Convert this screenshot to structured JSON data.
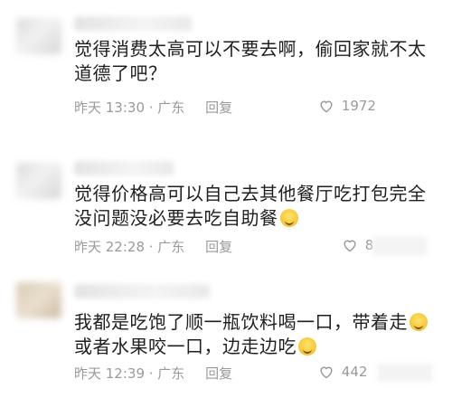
{
  "comments": [
    {
      "lines": [
        "觉得消费太高可以不要去啊，偷回家就不太",
        "道德了吧？"
      ],
      "time": "昨天 13:30 · 广东",
      "reply": "回复",
      "likes": "1972"
    },
    {
      "lines": [
        "觉得价格高可以自己去其他餐厅吃打包完全",
        "没问题没必要去吃自助餐"
      ],
      "time": "昨天 22:28 · 广东",
      "reply": "回复",
      "likes": "8"
    },
    {
      "lines": [
        "我都是吃饱了顺一瓶饮料喝一口，带着走",
        "或者水果咬一口，边走边吃"
      ],
      "time": "昨天 12:39 · 广东",
      "reply": "回复",
      "likes": "442"
    }
  ],
  "icons": {
    "like": "heart-outline-icon",
    "emoji_smile": "smiling-face-emoji",
    "emoji_laugh": "laughing-tears-emoji"
  },
  "colors": {
    "text": "#1f1f1f",
    "meta": "#9a9a9a",
    "background": "#ffffff"
  }
}
